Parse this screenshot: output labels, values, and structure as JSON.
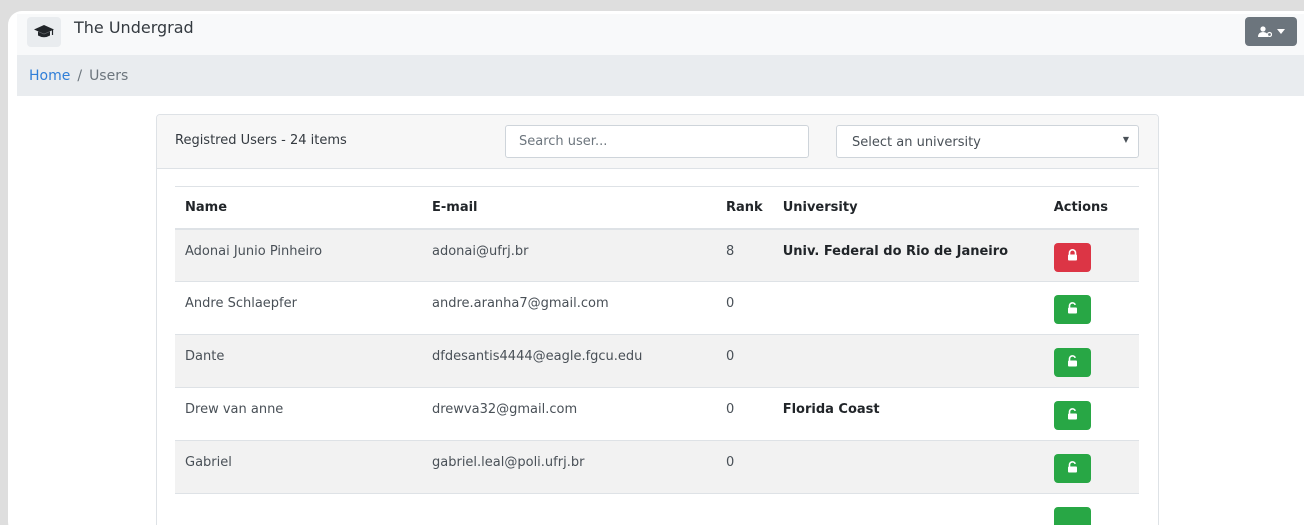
{
  "app": {
    "brand": "The Undergrad"
  },
  "breadcrumb": {
    "home": "Home",
    "separator": "/",
    "current": "Users"
  },
  "card": {
    "title": "Registred Users - 24 items",
    "search_placeholder": "Search user...",
    "select_value": "Select an university"
  },
  "table": {
    "headers": [
      "Name",
      "E-mail",
      "Rank",
      "University",
      "Actions"
    ],
    "rows": [
      {
        "name": "Adonai Junio Pinheiro",
        "email": "adonai@ufrj.br",
        "rank": "8",
        "university": "Univ. Federal do Rio de Janeiro",
        "locked": true
      },
      {
        "name": "Andre Schlaepfer",
        "email": "andre.aranha7@gmail.com",
        "rank": "0",
        "university": "",
        "locked": false
      },
      {
        "name": "Dante",
        "email": "dfdesantis4444@eagle.fgcu.edu",
        "rank": "0",
        "university": "",
        "locked": false
      },
      {
        "name": "Drew van anne",
        "email": "drewva32@gmail.com",
        "rank": "0",
        "university": "Florida Coast",
        "locked": false
      },
      {
        "name": "Gabriel",
        "email": "gabriel.leal@poli.ufrj.br",
        "rank": "0",
        "university": "",
        "locked": false
      }
    ]
  },
  "icons": {
    "brand": "graduation-cap-icon",
    "user_menu": "user-cog-icon",
    "lock": "lock-icon",
    "unlock": "unlock-icon"
  },
  "colors": {
    "link": "#2f7ed8",
    "danger": "#dc3545",
    "success": "#28a745",
    "secondary": "#6c757d"
  }
}
